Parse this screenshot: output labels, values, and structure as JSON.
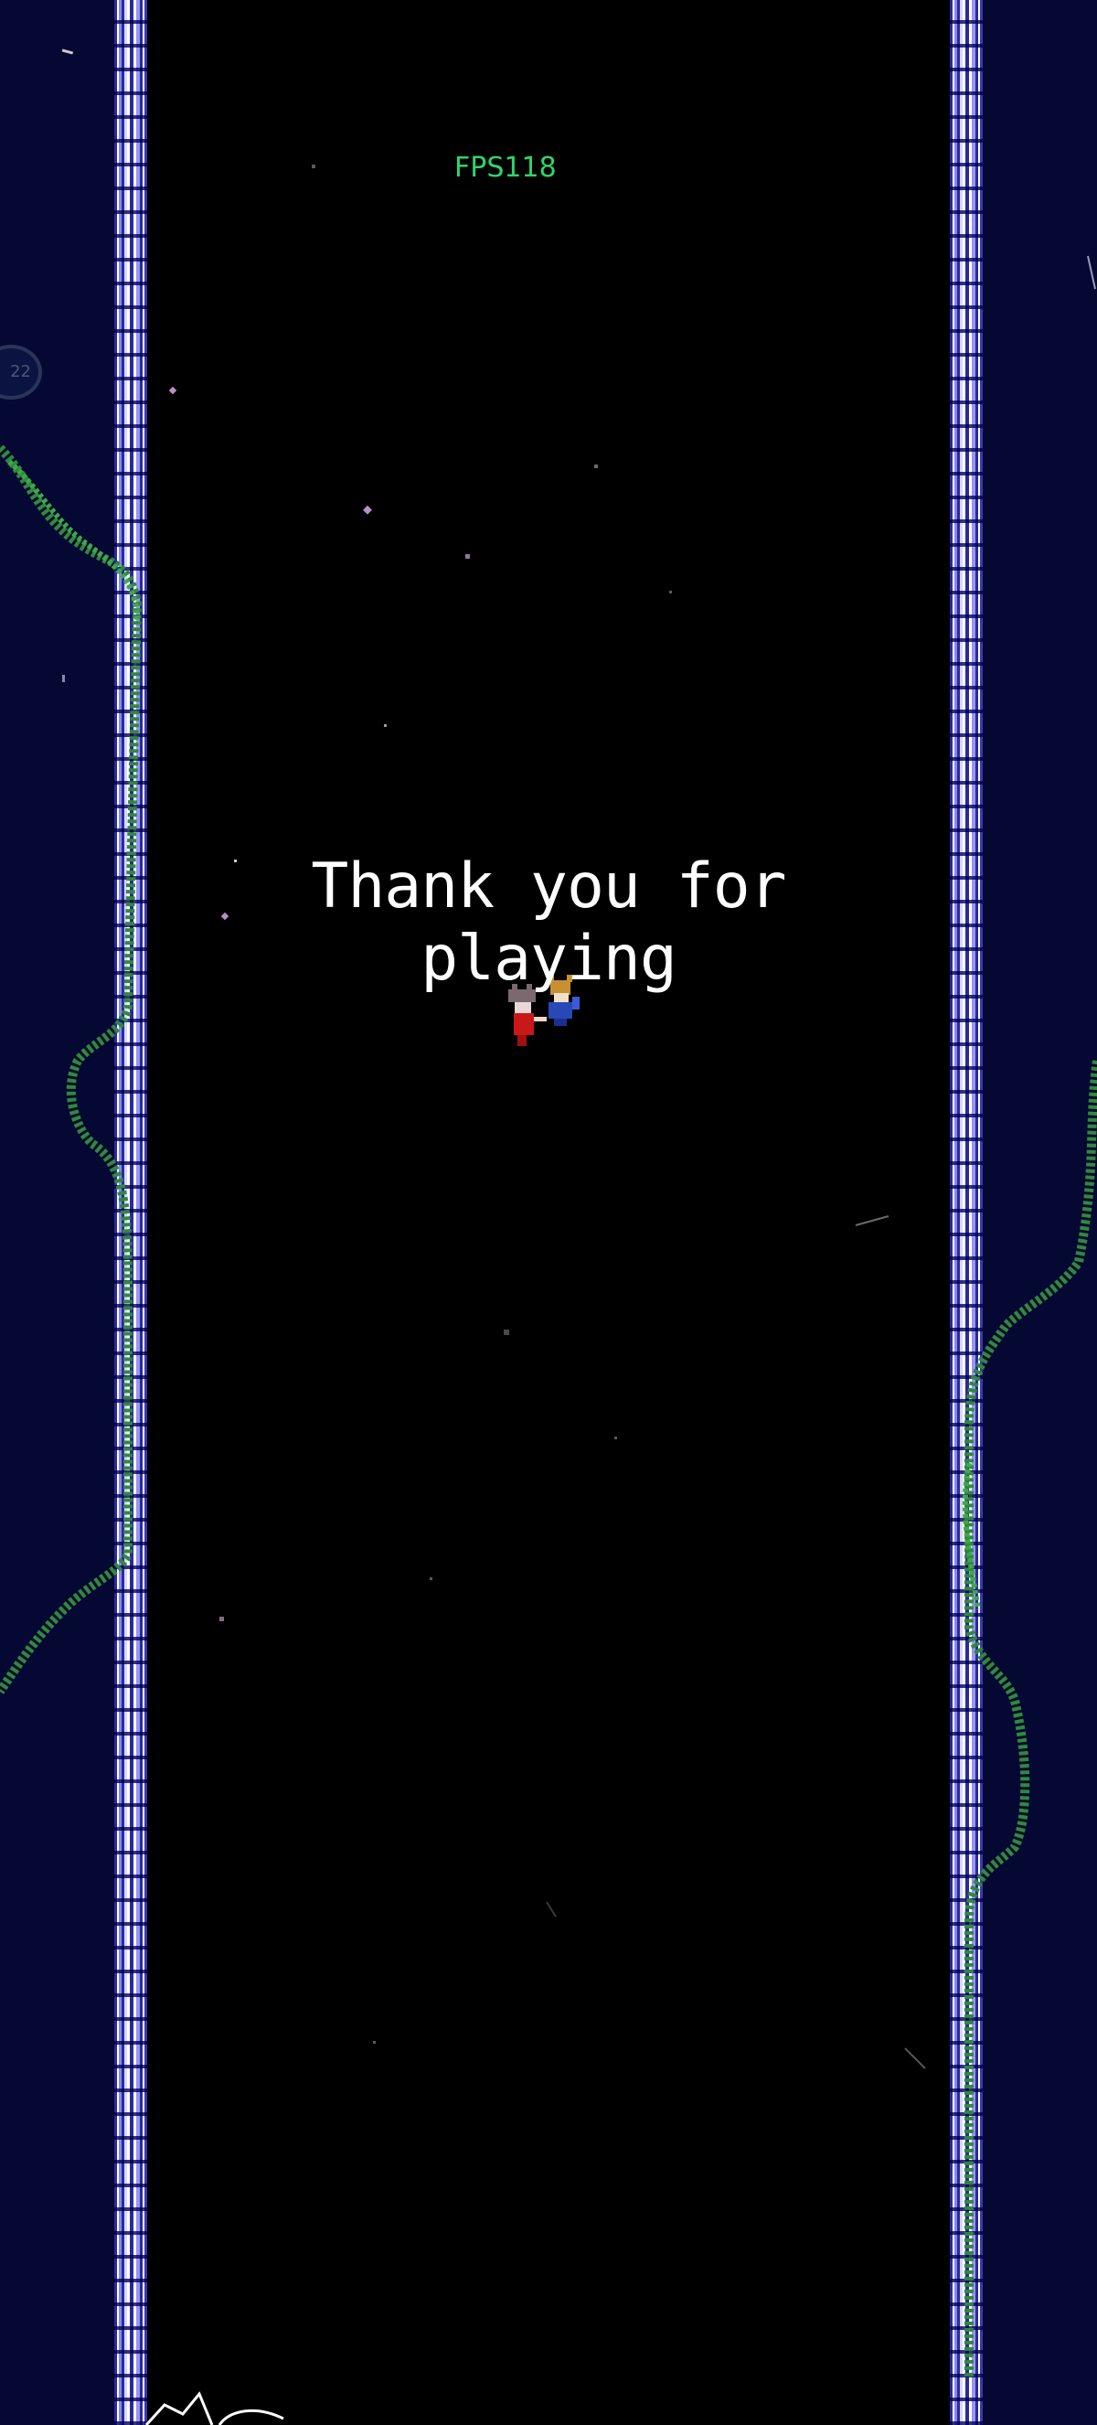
{
  "hud": {
    "fps_label": "FPS118"
  },
  "message": {
    "text": "Thank you for playing"
  },
  "side_badge": {
    "text": "22"
  },
  "colors": {
    "playfield": "#000000",
    "side_background": "#050833",
    "pillar": "#8a88e8",
    "vine": "#2f8a3a",
    "fps_text": "#2ed56a",
    "message_text": "#ffffff"
  },
  "sprites": {
    "characters": [
      "player-character-red",
      "companion-character-blue"
    ]
  }
}
